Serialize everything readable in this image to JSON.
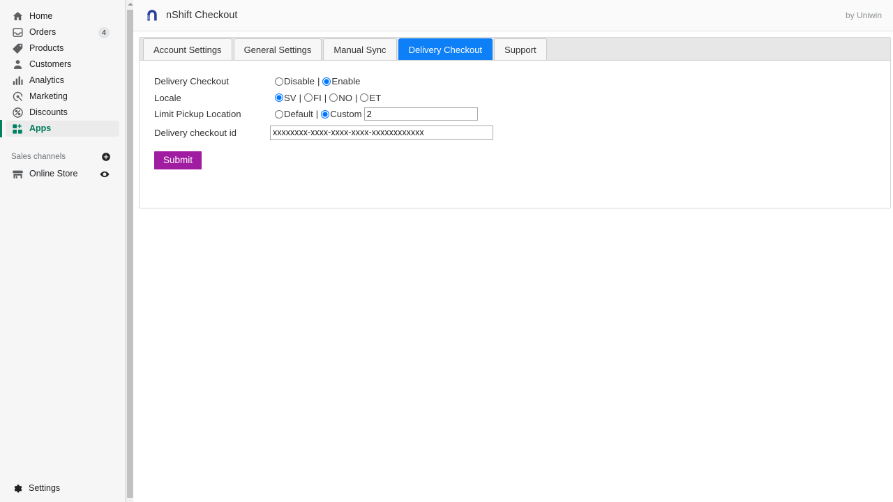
{
  "sidebar": {
    "items": [
      {
        "label": "Home",
        "icon": "home-icon",
        "badge": null,
        "active": false
      },
      {
        "label": "Orders",
        "icon": "orders-icon",
        "badge": "4",
        "active": false
      },
      {
        "label": "Products",
        "icon": "products-icon",
        "badge": null,
        "active": false
      },
      {
        "label": "Customers",
        "icon": "customers-icon",
        "badge": null,
        "active": false
      },
      {
        "label": "Analytics",
        "icon": "analytics-icon",
        "badge": null,
        "active": false
      },
      {
        "label": "Marketing",
        "icon": "marketing-icon",
        "badge": null,
        "active": false
      },
      {
        "label": "Discounts",
        "icon": "discounts-icon",
        "badge": null,
        "active": false
      },
      {
        "label": "Apps",
        "icon": "apps-icon",
        "badge": null,
        "active": true
      }
    ],
    "sales_channels": {
      "heading": "Sales channels",
      "add_icon": "plus-circle-icon",
      "items": [
        {
          "label": "Online Store",
          "icon": "store-icon",
          "trailing_icon": "eye-icon"
        }
      ]
    },
    "settings": {
      "label": "Settings",
      "icon": "gear-icon"
    },
    "active_accent_color": "#008060",
    "active_text_color": "#007b5c"
  },
  "app_header": {
    "logo_icon": "nshift-arch-logo",
    "title": "nShift Checkout",
    "byline": "by Uniwin",
    "logo_color": "#2b3f9e"
  },
  "tabs": [
    {
      "label": "Account Settings",
      "active": false
    },
    {
      "label": "General Settings",
      "active": false
    },
    {
      "label": "Manual Sync",
      "active": false
    },
    {
      "label": "Delivery Checkout",
      "active": true
    },
    {
      "label": "Support",
      "active": false
    }
  ],
  "tab_active_color": "#0d7ff7",
  "form": {
    "rows": {
      "delivery_checkout": {
        "label": "Delivery Checkout",
        "options": [
          {
            "value": "disable",
            "label": "Disable",
            "checked": false
          },
          {
            "value": "enable",
            "label": "Enable",
            "checked": true
          }
        ],
        "separator": "|"
      },
      "locale": {
        "label": "Locale",
        "options": [
          {
            "value": "SV",
            "label": "SV",
            "checked": true
          },
          {
            "value": "FI",
            "label": "FI",
            "checked": false
          },
          {
            "value": "NO",
            "label": "NO",
            "checked": false
          },
          {
            "value": "ET",
            "label": "ET",
            "checked": false
          }
        ],
        "separator": "|"
      },
      "limit_pickup_location": {
        "label": "Limit Pickup Location",
        "options": [
          {
            "value": "default",
            "label": "Default",
            "checked": false
          },
          {
            "value": "custom",
            "label": "Custom",
            "checked": true
          }
        ],
        "separator": "|",
        "custom_value": "2",
        "custom_placeholder": ""
      },
      "delivery_checkout_id": {
        "label": "Delivery checkout id",
        "value": "xxxxxxxx-xxxx-xxxx-xxxx-xxxxxxxxxxxx",
        "placeholder": ""
      }
    },
    "submit_label": "Submit",
    "submit_color": "#a01ca0"
  }
}
